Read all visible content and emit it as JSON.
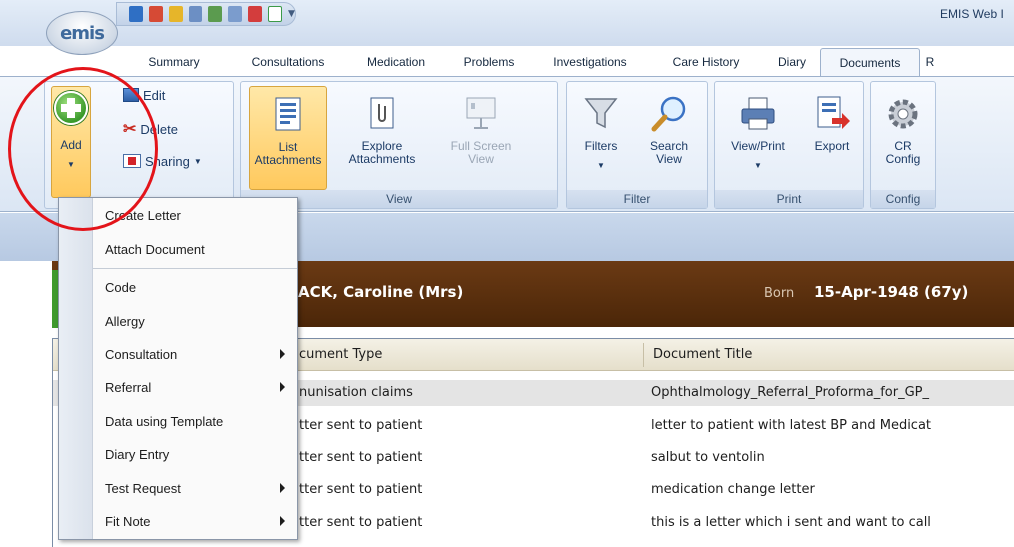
{
  "app": {
    "logo_text": "emis",
    "title": "EMIS Web I"
  },
  "tabs": [
    {
      "label": "Summary",
      "active": false
    },
    {
      "label": "Consultations",
      "active": false
    },
    {
      "label": "Medication",
      "active": false
    },
    {
      "label": "Problems",
      "active": false
    },
    {
      "label": "Investigations",
      "active": false
    },
    {
      "label": "Care History",
      "active": false
    },
    {
      "label": "Diary",
      "active": false
    },
    {
      "label": "Documents",
      "active": true
    },
    {
      "label": "R",
      "active": false
    }
  ],
  "ribbon": {
    "add": {
      "label": "Add"
    },
    "edit": {
      "label": "Edit"
    },
    "delete": {
      "label": "Delete"
    },
    "sharing": {
      "label": "Sharing"
    },
    "list_attachments": {
      "line1": "List",
      "line2": "Attachments"
    },
    "explore_attachments": {
      "line1": "Explore",
      "line2": "Attachments"
    },
    "full_screen_view": {
      "line1": "Full Screen",
      "line2": "View"
    },
    "filters": {
      "label": "Filters"
    },
    "search_view": {
      "line1": "Search",
      "line2": "View"
    },
    "view_print": {
      "label": "View/Print"
    },
    "export": {
      "label": "Export"
    },
    "cr_config": {
      "line1": "CR",
      "line2": "Config"
    },
    "groups": {
      "view": "View",
      "filter": "Filter",
      "print": "Print",
      "config": "Config"
    }
  },
  "menu": {
    "items": [
      {
        "label": "Create Letter",
        "submenu": false
      },
      {
        "label": "Attach Document",
        "submenu": false
      },
      {
        "label": "Code",
        "submenu": false
      },
      {
        "label": "Allergy",
        "submenu": false
      },
      {
        "label": "Consultation",
        "submenu": true
      },
      {
        "label": "Referral",
        "submenu": true
      },
      {
        "label": "Data using Template",
        "submenu": false
      },
      {
        "label": "Diary Entry",
        "submenu": false
      },
      {
        "label": "Test Request",
        "submenu": true
      },
      {
        "label": "Fit Note",
        "submenu": true
      }
    ]
  },
  "patient": {
    "name": "ACK, Caroline (Mrs)",
    "born_label": "Born",
    "born_value": "15-Apr-1948 (67y)"
  },
  "grid": {
    "headers": {
      "type": "cument Type",
      "title": "Document Title"
    },
    "rows": [
      {
        "type": "nunisation claims",
        "title": "Ophthalmology_Referral_Proforma_for_GP_",
        "selected": true
      },
      {
        "type": "tter sent to patient",
        "title": "letter to patient with latest BP and Medicat",
        "selected": false
      },
      {
        "type": "tter sent to patient",
        "title": "salbut to ventolin",
        "selected": false
      },
      {
        "type": "tter sent to patient",
        "title": "medication change letter",
        "selected": false
      },
      {
        "type": "tter sent to patient",
        "title": "this is a letter which i sent and want to call",
        "selected": false
      }
    ]
  },
  "colors": {
    "accent_red": "#e3141a",
    "banner_brown": "#5a2f0e",
    "highlight_orange": "#ffc95d",
    "add_green": "#3a9a2c"
  }
}
